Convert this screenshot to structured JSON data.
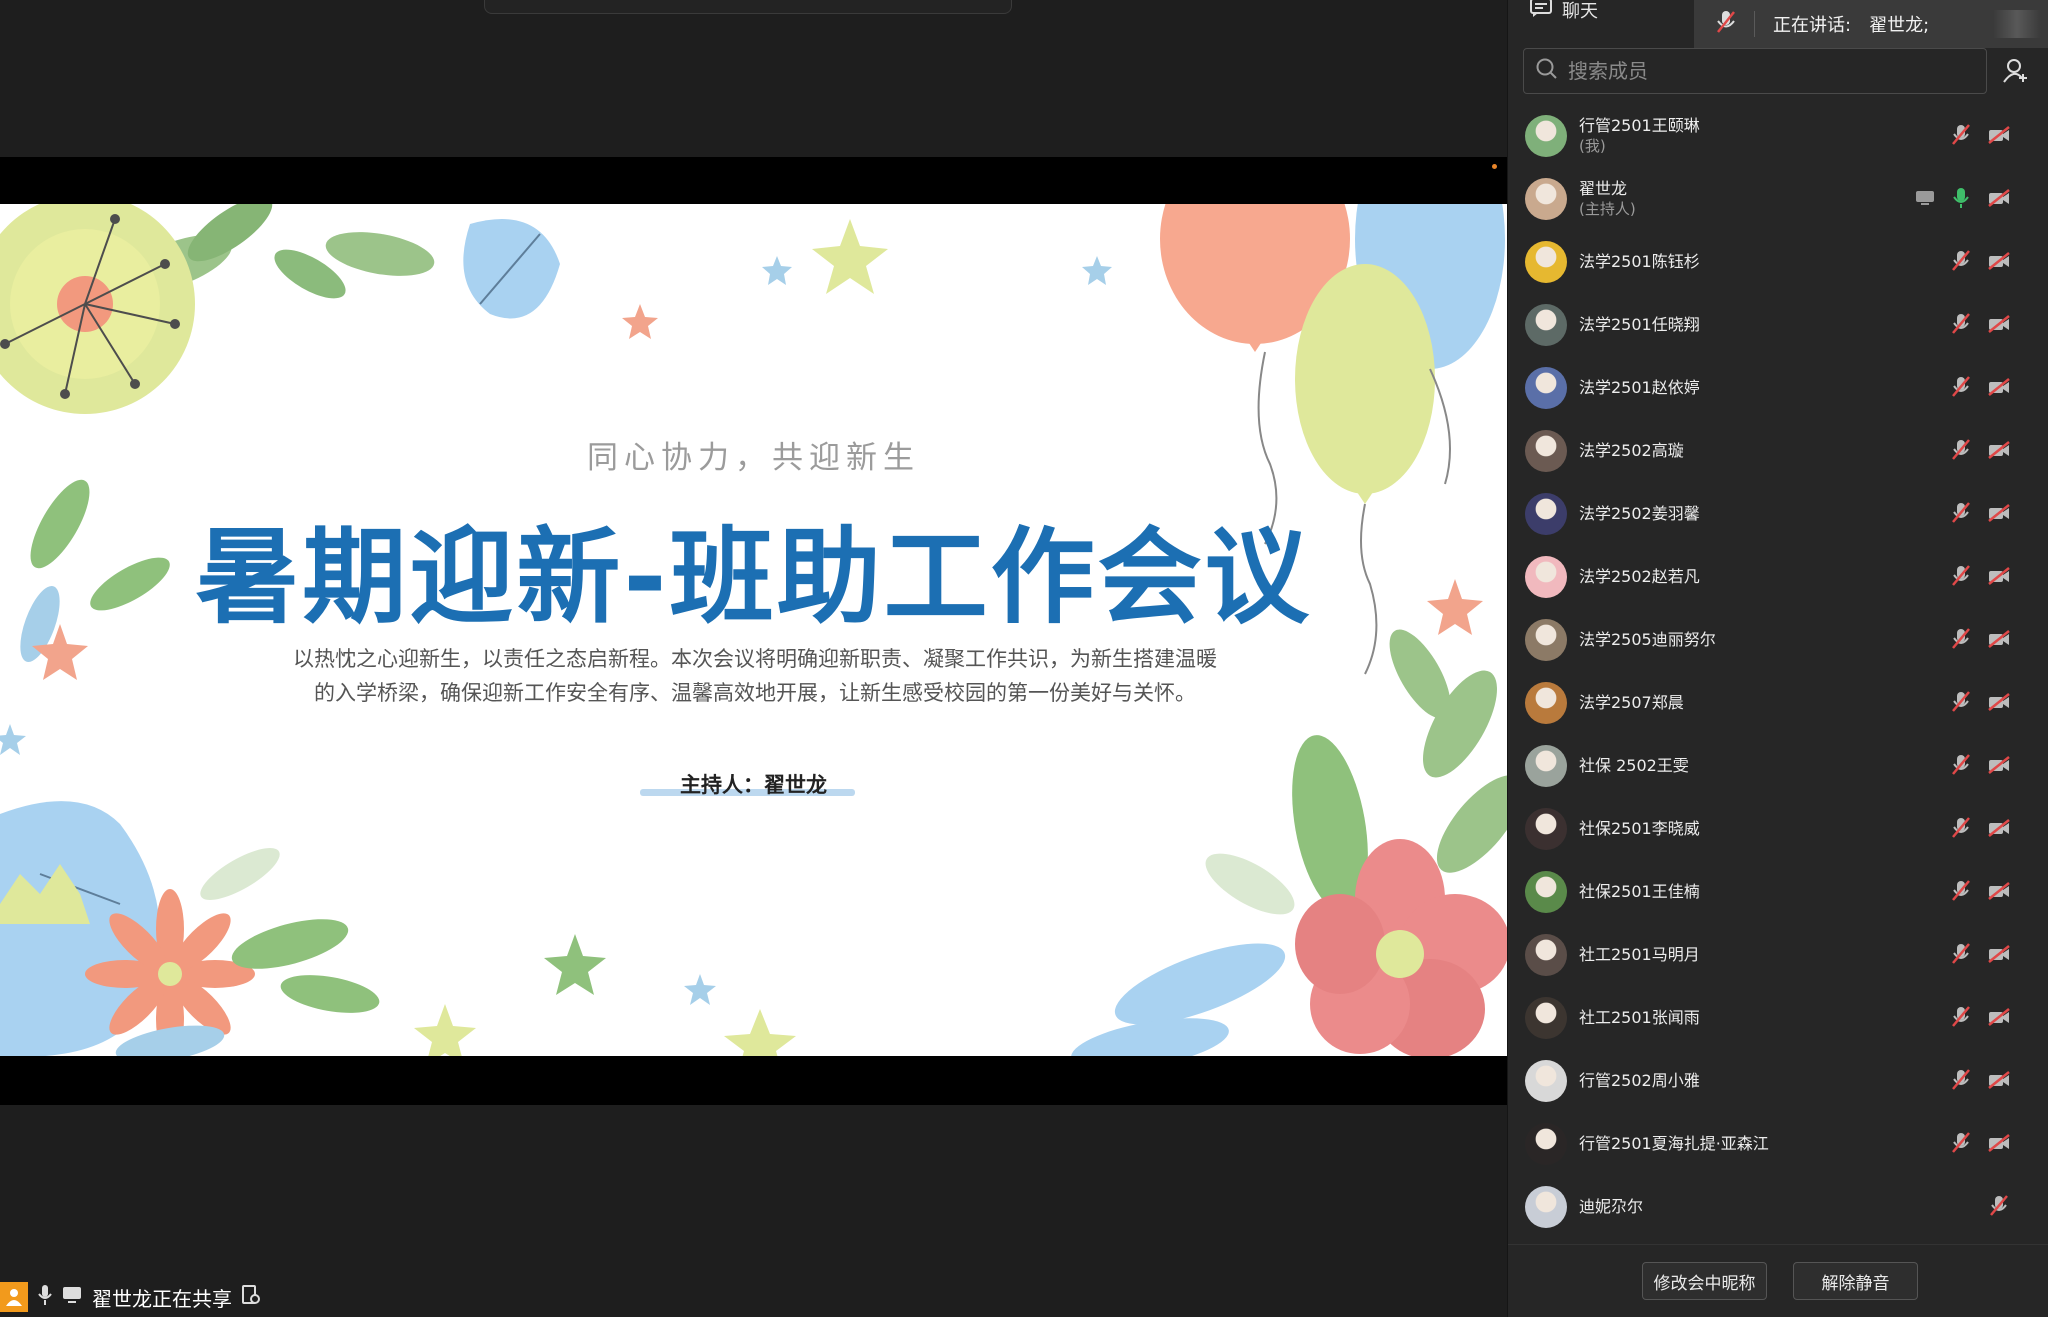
{
  "slide": {
    "subtitle": "同心协力，共迎新生",
    "title": "暑期迎新-班助工作会议",
    "description_line1": "以热忱之心迎新生，以责任之态启新程。本次会议将明确迎新职责、凝聚工作共识，为新生搭建温暖",
    "description_line2": "的入学桥梁，确保迎新工作安全有序、温馨高效地开展，让新生感受校园的第一份美好与关怀。",
    "host": "主持人：翟世龙"
  },
  "status": {
    "text": "翟世龙正在共享"
  },
  "panel": {
    "chat_tab": "聊天",
    "speaking_label": "正在讲话:",
    "speaking_name": "翟世龙;",
    "search_placeholder": "搜索成员",
    "footer": {
      "rename": "修改会中昵称",
      "unmute": "解除静音"
    }
  },
  "members": [
    {
      "name": "行管2501王颐琳",
      "role": "(我)",
      "avatar_color": "#7fb07a",
      "mic": "muted",
      "cam": "off"
    },
    {
      "name": "翟世龙",
      "role": "(主持人)",
      "avatar_color": "#c9a98e",
      "mic": "on",
      "cam": "off",
      "sharing": true
    },
    {
      "name": "法学2501陈钰杉",
      "role": "",
      "avatar_color": "#e6b830",
      "mic": "muted",
      "cam": "off"
    },
    {
      "name": "法学2501任晓翔",
      "role": "",
      "avatar_color": "#5d6a66",
      "mic": "muted",
      "cam": "off"
    },
    {
      "name": "法学2501赵依婷",
      "role": "",
      "avatar_color": "#5a6fa8",
      "mic": "muted",
      "cam": "off"
    },
    {
      "name": "法学2502高璇",
      "role": "",
      "avatar_color": "#6b5a52",
      "mic": "muted",
      "cam": "off"
    },
    {
      "name": "法学2502姜羽馨",
      "role": "",
      "avatar_color": "#3c3d6a",
      "mic": "muted",
      "cam": "off"
    },
    {
      "name": "法学2502赵若凡",
      "role": "",
      "avatar_color": "#f1b9be",
      "mic": "muted",
      "cam": "off"
    },
    {
      "name": "法学2505迪丽努尔",
      "role": "",
      "avatar_color": "#8c7a66",
      "mic": "muted",
      "cam": "off"
    },
    {
      "name": "法学2507郑晨",
      "role": "",
      "avatar_color": "#b97a3c",
      "mic": "muted",
      "cam": "off"
    },
    {
      "name": "社保 2502王雯",
      "role": "",
      "avatar_color": "#9aa39c",
      "mic": "muted",
      "cam": "off"
    },
    {
      "name": "社保2501李晓威",
      "role": "",
      "avatar_color": "#3b3030",
      "mic": "muted",
      "cam": "off"
    },
    {
      "name": "社保2501王佳楠",
      "role": "",
      "avatar_color": "#5a8a4a",
      "mic": "muted",
      "cam": "off"
    },
    {
      "name": "社工2501马明月",
      "role": "",
      "avatar_color": "#5a4d48",
      "mic": "muted",
      "cam": "off"
    },
    {
      "name": "社工2501张闻雨",
      "role": "",
      "avatar_color": "#3c3530",
      "mic": "muted",
      "cam": "off"
    },
    {
      "name": "行管2502周小雅",
      "role": "",
      "avatar_color": "#d8d8d8",
      "mic": "muted",
      "cam": "off"
    },
    {
      "name": "行管2501夏海扎提·亚森江",
      "role": "",
      "avatar_color": "#2a2626",
      "mic": "muted",
      "cam": "off"
    },
    {
      "name": "迪妮尕尔",
      "role": "",
      "avatar_color": "#c8cdd6",
      "mic": "muted",
      "cam": "none"
    }
  ],
  "colors": {
    "accent_blue": "#1c6fb3",
    "mute_red": "#e04848",
    "mic_green": "#3fbf6a",
    "status_orange": "#f29a1c"
  }
}
